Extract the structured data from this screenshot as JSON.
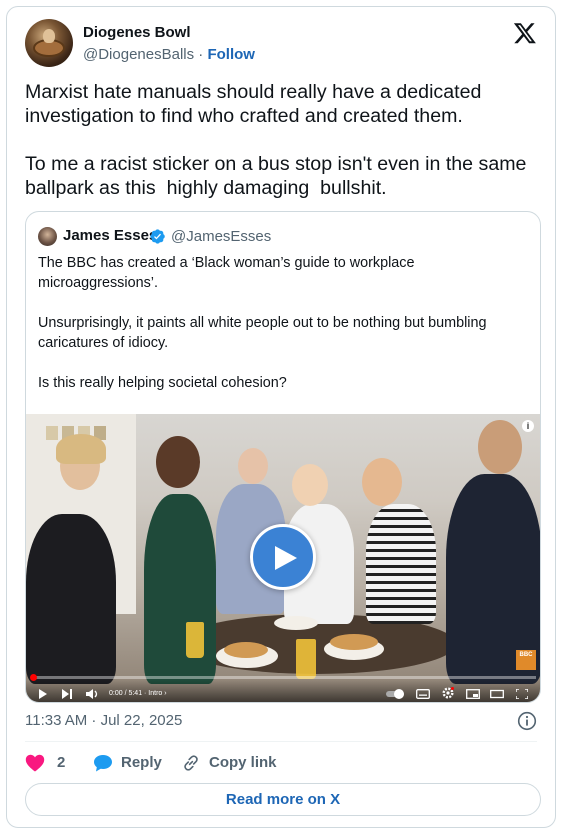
{
  "author": {
    "name": "Diogenes Bowl",
    "handle": "@DiogenesBalls",
    "separator": "·",
    "follow_label": "Follow"
  },
  "tweet": {
    "text": "Marxist hate manuals should really have a dedicated\ninvestigation to find who crafted and created them.\n\nTo me a racist sticker on a bus stop isn't even in the same\nballpark as this  highly damaging  bullshit.",
    "timestamp": "11:33 AM · Jul 22, 2025"
  },
  "quote": {
    "name": "James Esses",
    "handle": "@JamesEsses",
    "verified": true,
    "text": "The BBC has created a ‘Black woman’s guide to workplace\nmicroaggressions’.\n\nUnsurprisingly, it paints all white people out to be nothing but bumbling\ncaricatures of idiocy.\n\nIs this really helping societal cohesion?"
  },
  "video": {
    "time": "0:00 / 5:41 · Intro ›",
    "progress": 0,
    "play_icon": "play-icon",
    "accent": "#3b82d4"
  },
  "actions": {
    "like_count": "2",
    "reply_label": "Reply",
    "copy_label": "Copy link"
  },
  "read_more_label": "Read more on X",
  "colors": {
    "link": "#1d66b5",
    "like": "#f91880",
    "muted": "#536471",
    "border": "#cfd9de"
  }
}
